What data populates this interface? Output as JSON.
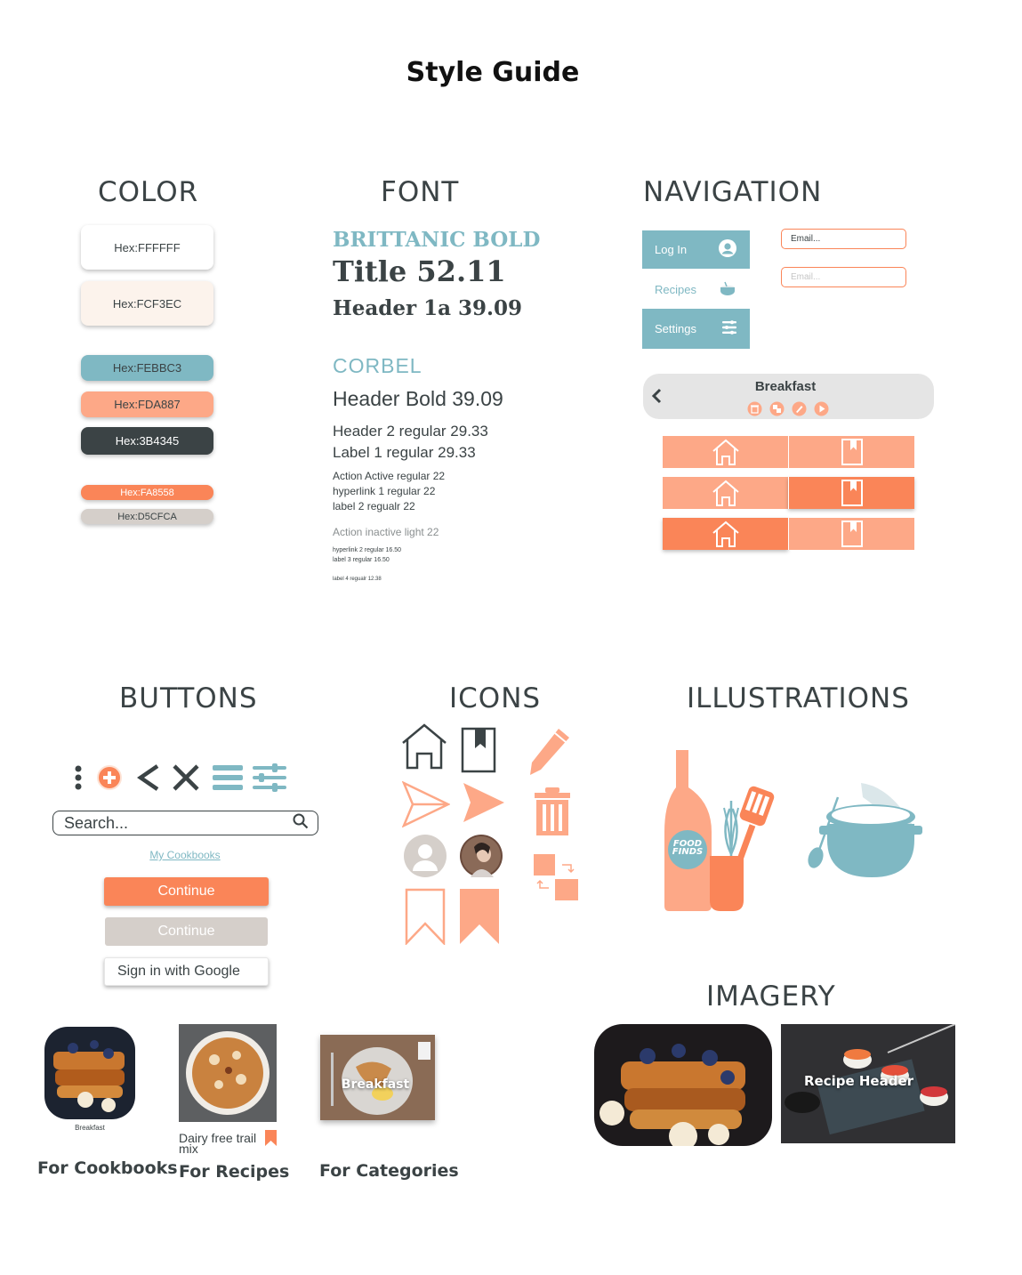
{
  "page_title": "Style Guide",
  "sections": {
    "color": "COLOR",
    "font": "FONT",
    "navigation": "NAVIGATION",
    "buttons": "BUTTONS",
    "icons": "ICONS",
    "illustrations": "ILLUSTRATIONS",
    "imagery": "IMAGERY"
  },
  "colors": [
    {
      "label": "Hex:FFFFFF",
      "hex": "#FFFFFF"
    },
    {
      "label": "Hex:FCF3EC",
      "hex": "#FCF3EC"
    },
    {
      "label": "Hex:FEBBC3",
      "hex": "#7FB8C3"
    },
    {
      "label": "Hex:FDA887",
      "hex": "#FDA887"
    },
    {
      "label": "Hex:3B4345",
      "hex": "#3B4345"
    },
    {
      "label": "Hex:FA8558",
      "hex": "#FA8558"
    },
    {
      "label": "Hex:D5CFCA",
      "hex": "#D5CFCA"
    }
  ],
  "fonts": {
    "brittanic_heading": "BRITTANIC BOLD",
    "title_sample": "Title 52.11",
    "header1a_sample": "Header 1a 39.09",
    "corbel_heading": "CORBEL",
    "header_bold": "Header Bold 39.09",
    "header2": "Header 2 regular 29.33",
    "label1": "Label 1 regular 29.33",
    "action_active": "Action Active regular 22",
    "hyperlink1": "hyperlink 1 regular 22",
    "label2": "label 2 regualr 22",
    "action_inactive": "Action inactive light 22",
    "hyperlink2": "hyperlink 2 regular 16.50",
    "label3": "label 3 regular 16.50",
    "label4": "label 4 regualr 12.38"
  },
  "navigation": {
    "login": "Log In",
    "recipes": "Recipes",
    "settings": "Settings",
    "email_placeholder_1": "Email...",
    "email_placeholder_2": "Email...",
    "category_bar_title": "Breakfast"
  },
  "buttons": {
    "search_placeholder": "Search...",
    "link": "My Cookbooks",
    "continue_active": "Continue",
    "continue_inactive": "Continue",
    "google": "Sign in with Google"
  },
  "illustrations": {
    "bottle_label": "FOOD FINDS"
  },
  "cards": {
    "cookbook_caption": "Breakfast",
    "cookbook_label": "For Cookbooks",
    "recipe_caption": "Dairy free trail mix",
    "recipe_label": "For Recipes",
    "category_caption": "Breakfast",
    "category_label": "For Categories"
  },
  "imagery": {
    "recipe_header": "Recipe Header"
  }
}
